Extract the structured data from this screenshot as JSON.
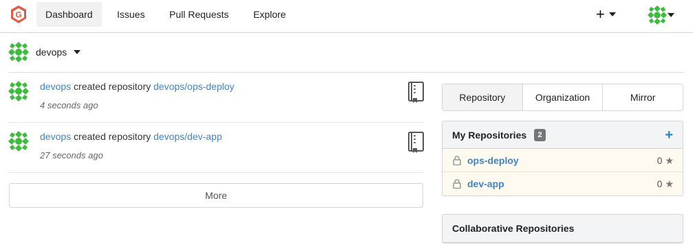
{
  "navbar": {
    "logo_icon": "gitea-logo-icon",
    "items": [
      {
        "label": "Dashboard",
        "active": true
      },
      {
        "label": "Issues",
        "active": false
      },
      {
        "label": "Pull Requests",
        "active": false
      },
      {
        "label": "Explore",
        "active": false
      }
    ],
    "create_icon": "plus-icon",
    "plus_symbol": "+",
    "user_avatar_icon": "identicon-avatar-icon"
  },
  "context": {
    "user": "devops",
    "switch_icon": "chevron-down-icon"
  },
  "feed": [
    {
      "actor": "devops",
      "action": "created repository",
      "repo": "devops/ops-deploy",
      "time": "4 seconds ago",
      "icon": "book-icon"
    },
    {
      "actor": "devops",
      "action": "created repository",
      "repo": "devops/dev-app",
      "time": "27 seconds ago",
      "icon": "book-icon"
    }
  ],
  "more_label": "More",
  "tabs": [
    {
      "label": "Repository",
      "active": true
    },
    {
      "label": "Organization",
      "active": false
    },
    {
      "label": "Mirror",
      "active": false
    }
  ],
  "my_repositories": {
    "title": "My Repositories",
    "count": "2",
    "add_symbol": "+",
    "items": [
      {
        "name": "ops-deploy",
        "stars": "0",
        "private": true
      },
      {
        "name": "dev-app",
        "stars": "0",
        "private": true
      }
    ]
  },
  "collab": {
    "title": "Collaborative Repositories"
  },
  "colors": {
    "link": "#4183c4",
    "accent_blue": "#2185d0",
    "brand_red": "#e05d44",
    "avatar_green": "#3bbd3b",
    "repo_row_bg": "#fffaf0"
  }
}
